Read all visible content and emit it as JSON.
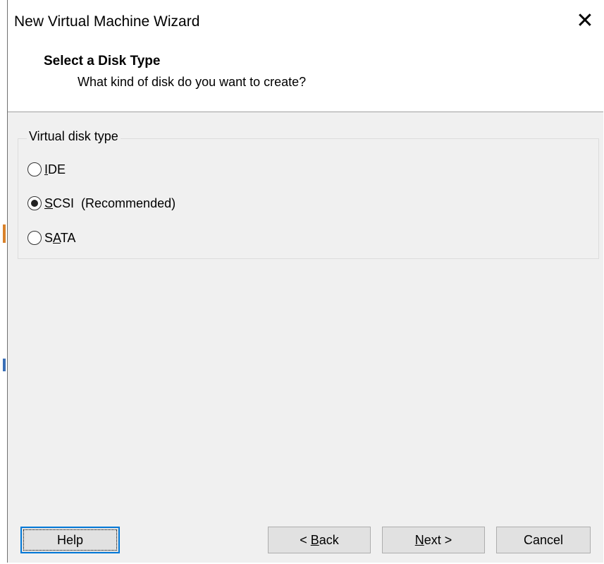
{
  "window": {
    "title": "New Virtual Machine Wizard",
    "close_symbol": "✕"
  },
  "header": {
    "title": "Select a Disk Type",
    "subtitle": "What kind of disk do you want to create?"
  },
  "disk_type_group": {
    "legend": "Virtual disk type",
    "options": [
      {
        "mnemonic": "I",
        "rest": "DE",
        "suffix": "",
        "checked": false
      },
      {
        "mnemonic": "S",
        "rest": "CSI",
        "suffix": "(Recommended)",
        "checked": true
      },
      {
        "mnemonic_prefix": "S",
        "mnemonic": "A",
        "rest": "TA",
        "suffix": "",
        "checked": false
      }
    ]
  },
  "buttons": {
    "help": "Help",
    "back_prefix": "< ",
    "back_mnemonic": "B",
    "back_rest": "ack",
    "next_mnemonic": "N",
    "next_rest": "ext >",
    "cancel": "Cancel"
  },
  "colors": {
    "dialog_background": "#f0f0f0",
    "focus_border": "#0078d7",
    "button_face": "#e1e1e1"
  }
}
